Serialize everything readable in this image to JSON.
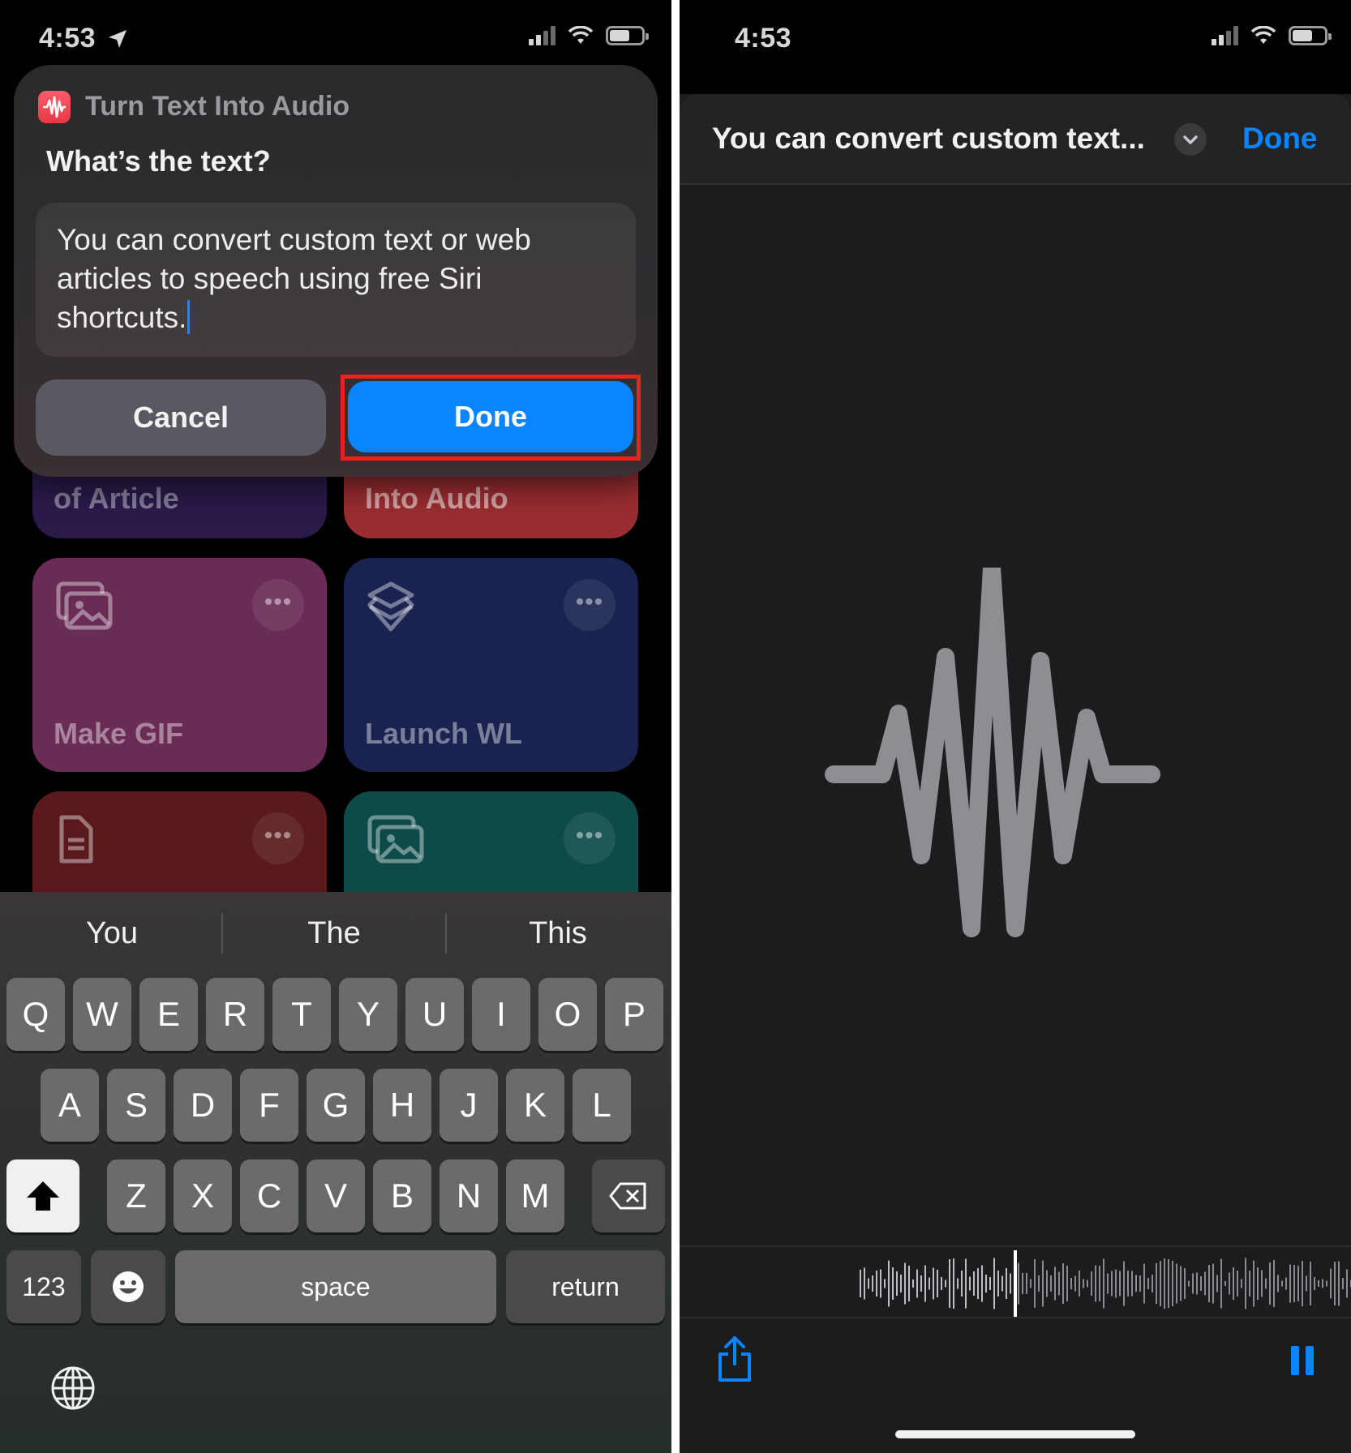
{
  "left_screen": {
    "status_time": "4:53",
    "prompt": {
      "app_name": "Turn Text Into Audio",
      "question": "What’s the text?",
      "text_value": "You can convert custom text or web articles to speech using free Siri shortcuts.",
      "cancel_label": "Cancel",
      "done_label": "Done"
    },
    "tiles": [
      {
        "label": "of Article",
        "color": "#2a1a4a"
      },
      {
        "label": "Into Audio",
        "color": "#9a2d31"
      },
      {
        "label": "Make GIF",
        "color": "#6a2c57",
        "icon": "photos-icon"
      },
      {
        "label": "Launch WL",
        "color": "#1a2350",
        "icon": "layers-icon"
      },
      {
        "label": "",
        "color": "#5a1a1c",
        "icon": "document-icon"
      },
      {
        "label": "",
        "color": "#0d4a4a",
        "icon": "photos-icon"
      }
    ],
    "keyboard": {
      "suggestions": [
        "You",
        "The",
        "This"
      ],
      "row1": [
        "Q",
        "W",
        "E",
        "R",
        "T",
        "Y",
        "U",
        "I",
        "O",
        "P"
      ],
      "row2": [
        "A",
        "S",
        "D",
        "F",
        "G",
        "H",
        "J",
        "K",
        "L"
      ],
      "row3": [
        "Z",
        "X",
        "C",
        "V",
        "B",
        "N",
        "M"
      ],
      "numbers_label": "123",
      "space_label": "space",
      "return_label": "return"
    }
  },
  "right_screen": {
    "status_time": "4:53",
    "title": "You can convert custom text...",
    "done_label": "Done",
    "accent_color": "#0a84ff"
  }
}
